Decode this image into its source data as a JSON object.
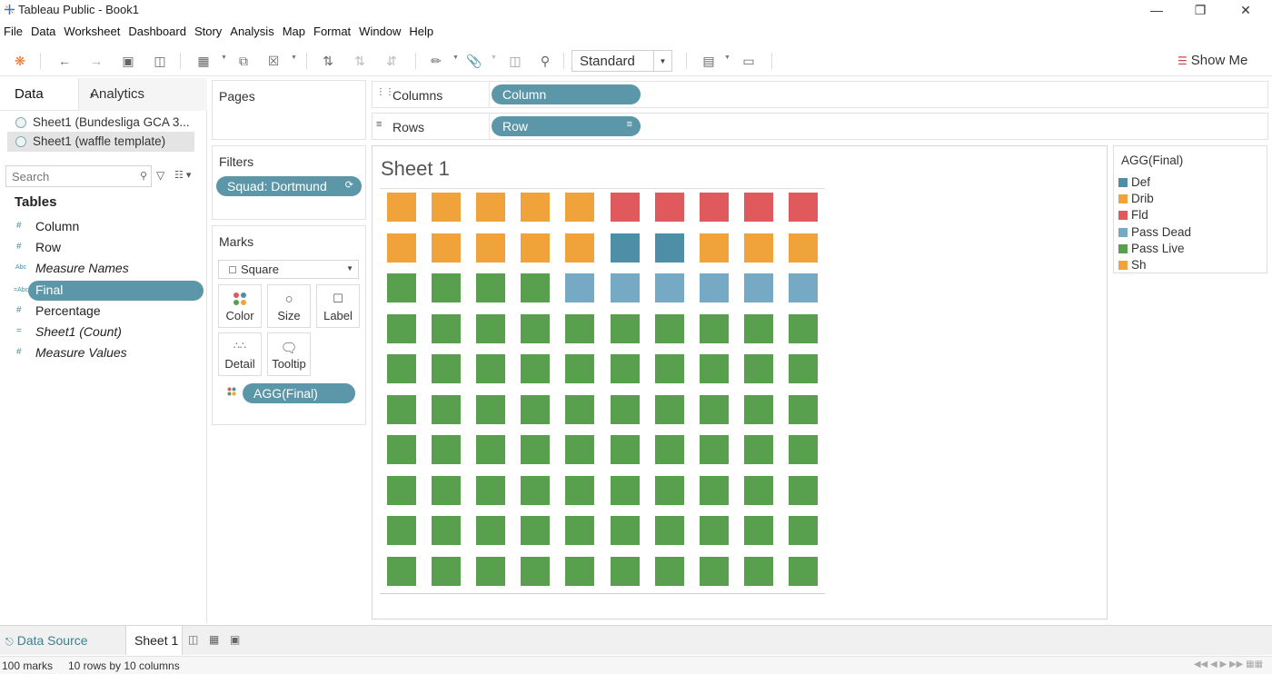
{
  "window": {
    "title": "Tableau Public - Book1"
  },
  "menu": [
    "File",
    "Data",
    "Worksheet",
    "Dashboard",
    "Story",
    "Analysis",
    "Map",
    "Format",
    "Window",
    "Help"
  ],
  "toolbar": {
    "fit_value": "Standard",
    "show_me_label": "Show Me"
  },
  "data_pane": {
    "tab_data": "Data",
    "tab_analytics": "Analytics",
    "datasources": [
      "Sheet1 (Bundesliga GCA 3...",
      "Sheet1 (waffle template)"
    ],
    "search_placeholder": "Search",
    "tables_heading": "Tables",
    "fields": [
      {
        "name": "Column",
        "type": "#"
      },
      {
        "name": "Row",
        "type": "#"
      },
      {
        "name": "Measure Names",
        "type": "Abc"
      },
      {
        "name": "Final",
        "type": "=Abc"
      },
      {
        "name": "Percentage",
        "type": "#"
      },
      {
        "name": "Sheet1 (Count)",
        "type": "="
      },
      {
        "name": "Measure Values",
        "type": "#"
      }
    ]
  },
  "pages": {
    "title": "Pages"
  },
  "filters": {
    "title": "Filters",
    "pill": "Squad: Dortmund"
  },
  "marks": {
    "title": "Marks",
    "type": "Square",
    "buttons": [
      "Color",
      "Size",
      "Label",
      "Detail",
      "Tooltip"
    ],
    "pill": "AGG(Final)"
  },
  "shelves": {
    "columns_label": "Columns",
    "columns_pill": "Column",
    "rows_label": "Rows",
    "rows_pill": "Row"
  },
  "sheet": {
    "title": "Sheet 1"
  },
  "chart_data": {
    "type": "heatmap",
    "rows": 10,
    "columns": 10,
    "categories": [
      "Def",
      "Drib",
      "Fld",
      "Pass Dead",
      "Pass Live",
      "Sh"
    ],
    "colors": {
      "Def": "#4e8ea6",
      "Drib": "#f0a33a",
      "Fld": "#e05a5d",
      "Pass Dead": "#76aac4",
      "Pass Live": "#58a04e",
      "Sh": "#f0a33a"
    },
    "grid": [
      [
        "Drib",
        "Drib",
        "Drib",
        "Drib",
        "Drib",
        "Fld",
        "Fld",
        "Fld",
        "Fld",
        "Fld"
      ],
      [
        "Sh",
        "Sh",
        "Sh",
        "Sh",
        "Sh",
        "Def",
        "Def",
        "Drib",
        "Drib",
        "Drib"
      ],
      [
        "Pass Live",
        "Pass Live",
        "Pass Live",
        "Pass Live",
        "Pass Dead",
        "Pass Dead",
        "Pass Dead",
        "Pass Dead",
        "Pass Dead",
        "Pass Dead"
      ],
      [
        "Pass Live",
        "Pass Live",
        "Pass Live",
        "Pass Live",
        "Pass Live",
        "Pass Live",
        "Pass Live",
        "Pass Live",
        "Pass Live",
        "Pass Live"
      ],
      [
        "Pass Live",
        "Pass Live",
        "Pass Live",
        "Pass Live",
        "Pass Live",
        "Pass Live",
        "Pass Live",
        "Pass Live",
        "Pass Live",
        "Pass Live"
      ],
      [
        "Pass Live",
        "Pass Live",
        "Pass Live",
        "Pass Live",
        "Pass Live",
        "Pass Live",
        "Pass Live",
        "Pass Live",
        "Pass Live",
        "Pass Live"
      ],
      [
        "Pass Live",
        "Pass Live",
        "Pass Live",
        "Pass Live",
        "Pass Live",
        "Pass Live",
        "Pass Live",
        "Pass Live",
        "Pass Live",
        "Pass Live"
      ],
      [
        "Pass Live",
        "Pass Live",
        "Pass Live",
        "Pass Live",
        "Pass Live",
        "Pass Live",
        "Pass Live",
        "Pass Live",
        "Pass Live",
        "Pass Live"
      ],
      [
        "Pass Live",
        "Pass Live",
        "Pass Live",
        "Pass Live",
        "Pass Live",
        "Pass Live",
        "Pass Live",
        "Pass Live",
        "Pass Live",
        "Pass Live"
      ],
      [
        "Pass Live",
        "Pass Live",
        "Pass Live",
        "Pass Live",
        "Pass Live",
        "Pass Live",
        "Pass Live",
        "Pass Live",
        "Pass Live",
        "Pass Live"
      ]
    ]
  },
  "legend": {
    "title": "AGG(Final)",
    "items": [
      {
        "name": "Def",
        "color": "#4e8ea6"
      },
      {
        "name": "Drib",
        "color": "#f0a33a"
      },
      {
        "name": "Fld",
        "color": "#e05a5d"
      },
      {
        "name": "Pass Dead",
        "color": "#76aac4"
      },
      {
        "name": "Pass Live",
        "color": "#58a04e"
      },
      {
        "name": "Sh",
        "color": "#f0a33a"
      }
    ]
  },
  "tabs": {
    "data_source": "Data Source",
    "sheet": "Sheet 1"
  },
  "status": {
    "marks": "100 marks",
    "dims": "10 rows by 10 columns"
  }
}
